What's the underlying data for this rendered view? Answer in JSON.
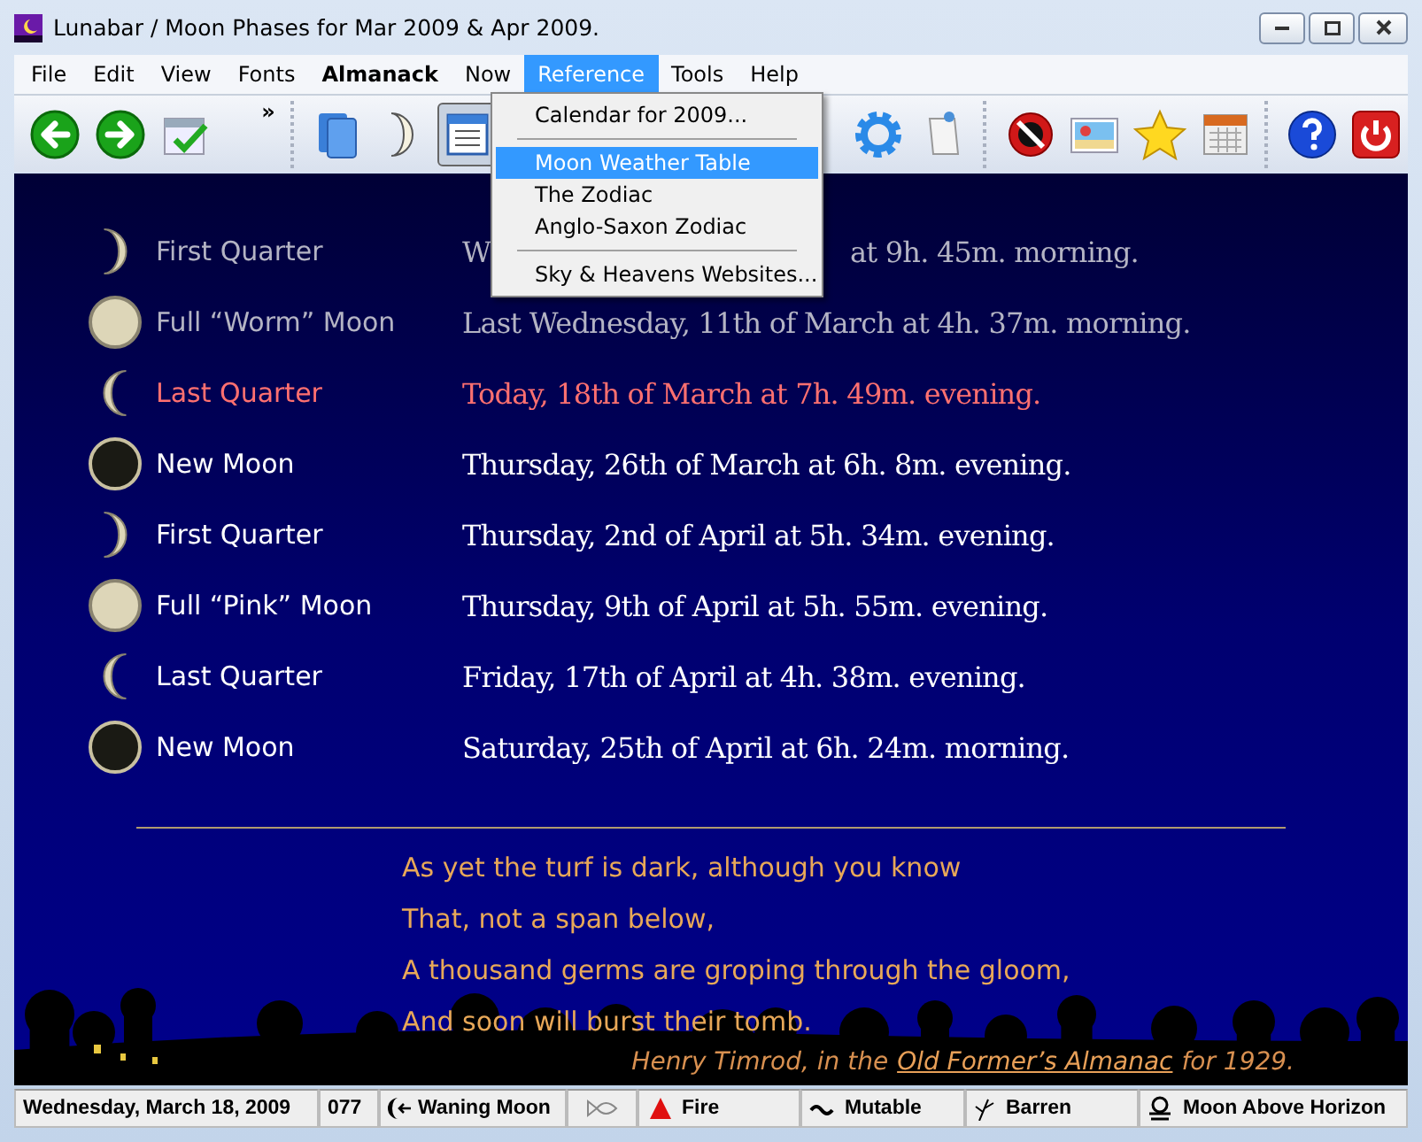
{
  "window": {
    "title": "Lunabar / Moon Phases for Mar 2009 & Apr 2009."
  },
  "menu_bar": [
    {
      "label": "File",
      "selected": false,
      "bold": false
    },
    {
      "label": "Edit",
      "selected": false,
      "bold": false
    },
    {
      "label": "View",
      "selected": false,
      "bold": false
    },
    {
      "label": "Fonts",
      "selected": false,
      "bold": false
    },
    {
      "label": "Almanack",
      "selected": false,
      "bold": true
    },
    {
      "label": "Now",
      "selected": false,
      "bold": false
    },
    {
      "label": "Reference",
      "selected": true,
      "bold": false
    },
    {
      "label": "Tools",
      "selected": false,
      "bold": false
    },
    {
      "label": "Help",
      "selected": false,
      "bold": false
    }
  ],
  "toolbar": [
    {
      "kind": "back",
      "selected": false
    },
    {
      "kind": "forward",
      "selected": false
    },
    {
      "kind": "calendar-check",
      "selected": false
    },
    {
      "kind": "overflow",
      "label": "»",
      "selected": false
    },
    {
      "kind": "separator"
    },
    {
      "kind": "book",
      "selected": false
    },
    {
      "kind": "moon",
      "selected": false
    },
    {
      "kind": "table",
      "selected": true
    },
    {
      "kind": "gap"
    },
    {
      "kind": "gear",
      "selected": false
    },
    {
      "kind": "note",
      "selected": false
    },
    {
      "kind": "separator"
    },
    {
      "kind": "no-sign",
      "selected": false
    },
    {
      "kind": "picture",
      "selected": false
    },
    {
      "kind": "star",
      "selected": false
    },
    {
      "kind": "calendar",
      "selected": false
    },
    {
      "kind": "separator"
    },
    {
      "kind": "help",
      "selected": false
    },
    {
      "kind": "power",
      "selected": false
    }
  ],
  "dropdown": [
    {
      "kind": "item",
      "label": "Calendar for 2009...",
      "selected": false
    },
    {
      "kind": "separator"
    },
    {
      "kind": "item",
      "label": "Moon Weather Table",
      "selected": true
    },
    {
      "kind": "item",
      "label": "The Zodiac",
      "selected": false
    },
    {
      "kind": "item",
      "label": "Anglo-Saxon Zodiac",
      "selected": false
    },
    {
      "kind": "separator"
    },
    {
      "kind": "item",
      "label": "Sky & Heavens Websites...",
      "selected": false
    }
  ],
  "phases": [
    {
      "kind": "first-quarter",
      "name": "First Quarter",
      "past": true,
      "current": false,
      "date": "W",
      "date_tail": "at 9h. 45m. morning."
    },
    {
      "kind": "full",
      "name": "Full “Worm” Moon",
      "past": true,
      "current": false,
      "date": "Last Wednesday, 11th of March at 4h. 37m. morning."
    },
    {
      "kind": "last-quarter",
      "name": "Last Quarter",
      "past": false,
      "current": true,
      "date": "Today, 18th of March at 7h. 49m. evening."
    },
    {
      "kind": "new",
      "name": "New Moon",
      "past": false,
      "current": false,
      "date": "Thursday, 26th of March at 6h. 8m. evening."
    },
    {
      "kind": "first-quarter",
      "name": "First Quarter",
      "past": false,
      "current": false,
      "date": "Thursday, 2nd of April at 5h. 34m. evening."
    },
    {
      "kind": "full",
      "name": "Full “Pink” Moon",
      "past": false,
      "current": false,
      "date": "Thursday, 9th of April at 5h. 55m. evening."
    },
    {
      "kind": "last-quarter",
      "name": "Last Quarter",
      "past": false,
      "current": false,
      "date": "Friday, 17th of April at 4h. 38m. evening."
    },
    {
      "kind": "new",
      "name": "New Moon",
      "past": false,
      "current": false,
      "date": "Saturday, 25th of April at 6h. 24m. morning."
    }
  ],
  "poem": {
    "lines": [
      "As yet the turf is dark, although you know",
      "That, not a span below,",
      "A thousand germs are groping through the gloom,",
      "And soon will burst their tomb."
    ],
    "attribution_before": "Henry Timrod, in the",
    "attribution_link": "Old Former’s Almanac",
    "attribution_after": "for 1929."
  },
  "status_bar": [
    {
      "kind": "text",
      "text": "Wednesday, March 18, 2009"
    },
    {
      "kind": "text",
      "text": "077"
    },
    {
      "kind": "waning",
      "text": "Waning Moon"
    },
    {
      "kind": "fish"
    },
    {
      "kind": "fire",
      "text": "Fire"
    },
    {
      "kind": "mutable",
      "text": "Mutable"
    },
    {
      "kind": "barren",
      "text": "Barren"
    },
    {
      "kind": "horizon",
      "text": "Moon Above Horizon"
    }
  ]
}
